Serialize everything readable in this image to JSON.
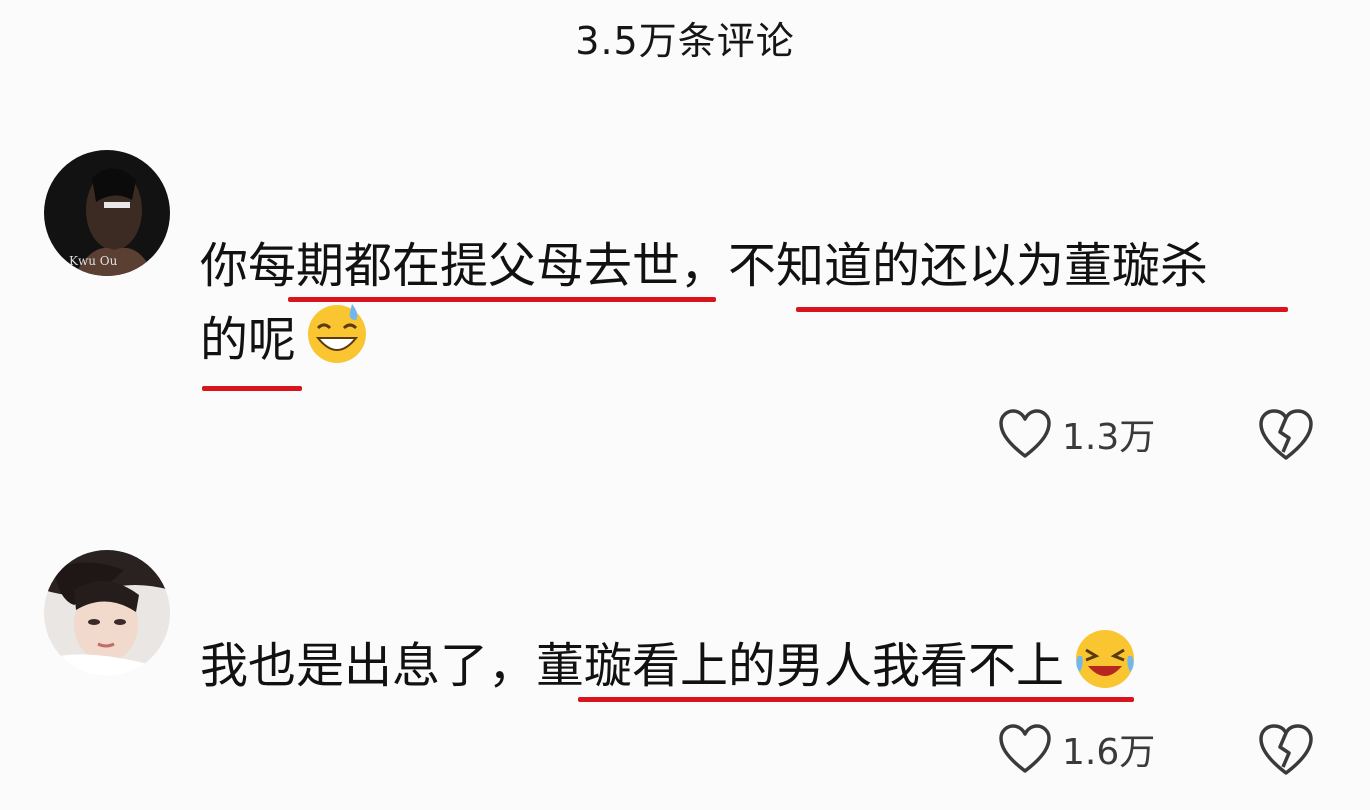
{
  "header": {
    "title": "3.5万条评论"
  },
  "comments": [
    {
      "text_line1": "你每期都在提父母去世，不知道的还以为董璇杀",
      "text_line2": "的呢",
      "like_count": "1.3万"
    },
    {
      "text_line1": "我也是出息了，董璇看上的男人我看不上",
      "like_count": "1.6万"
    }
  ],
  "colors": {
    "underline": "#d9141c",
    "text": "#111111",
    "icon": "#3a3a3a"
  }
}
